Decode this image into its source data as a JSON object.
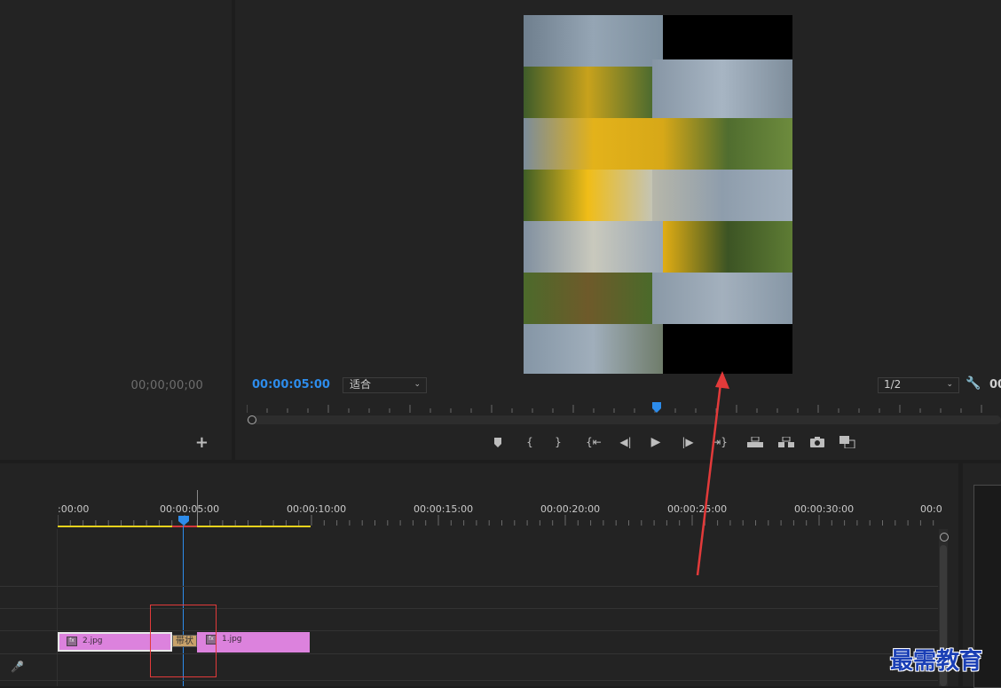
{
  "source_monitor": {
    "timecode": "00;00;00;00",
    "add_label": "+"
  },
  "program_monitor": {
    "timecode": "00:00:05:00",
    "zoom": "适合",
    "resolution": "1/2",
    "right_timecode": "00",
    "transport_icons": [
      "add-marker-icon",
      "mark-in-icon",
      "mark-out-icon",
      "go-to-in-icon",
      "step-back-icon",
      "play-icon",
      "step-forward-icon",
      "go-to-out-icon",
      "lift-icon",
      "extract-icon",
      "export-frame-icon",
      "comparison-view-icon"
    ]
  },
  "timeline": {
    "ruler_labels": [
      ":00:00",
      "00:00:05:00",
      "00:00:10:00",
      "00:00:15:00",
      "00:00:20:00",
      "00:00:25:00",
      "00:00:30:00",
      "00:0"
    ],
    "clips": [
      {
        "name": "2.jpg",
        "fx": "fx"
      },
      {
        "name": "1.jpg",
        "fx": "fx"
      }
    ],
    "transition_label": "带状"
  },
  "colors": {
    "accent": "#2d8ceb",
    "clip": "#dc82dd",
    "work_area": "#e6d21c",
    "annotation": "#e23a3a"
  },
  "watermark": "最需教育"
}
